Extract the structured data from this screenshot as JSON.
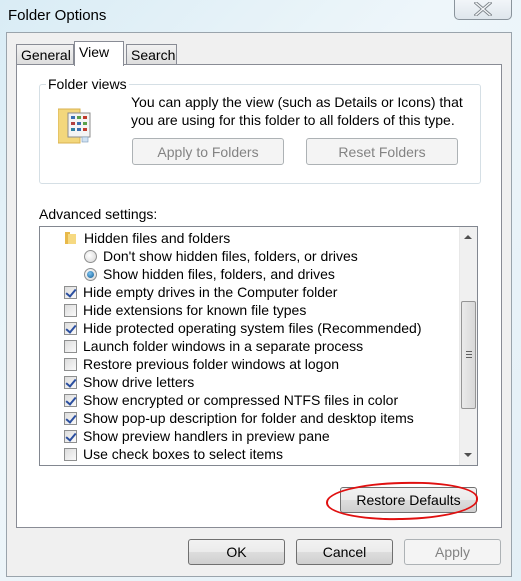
{
  "window": {
    "title": "Folder Options",
    "close_icon": "close-icon"
  },
  "tabs": [
    {
      "label": "General",
      "active": false
    },
    {
      "label": "View",
      "active": true
    },
    {
      "label": "Search",
      "active": false
    }
  ],
  "folder_views": {
    "legend": "Folder views",
    "icon": "folder-views-icon",
    "description": "You can apply the view (such as Details or Icons) that you are using for this folder to all folders of this type.",
    "apply_button": "Apply to Folders",
    "reset_button": "Reset Folders"
  },
  "advanced": {
    "label": "Advanced settings:",
    "items": [
      {
        "type": "folder",
        "label": "Hidden files and folders",
        "icon": "folder-icon"
      },
      {
        "type": "radio",
        "label": "Don't show hidden files, folders, or drives",
        "checked": false
      },
      {
        "type": "radio",
        "label": "Show hidden files, folders, and drives",
        "checked": true
      },
      {
        "type": "checkbox",
        "label": "Hide empty drives in the Computer folder",
        "checked": true
      },
      {
        "type": "checkbox",
        "label": "Hide extensions for known file types",
        "checked": false
      },
      {
        "type": "checkbox",
        "label": "Hide protected operating system files (Recommended)",
        "checked": true
      },
      {
        "type": "checkbox",
        "label": "Launch folder windows in a separate process",
        "checked": false
      },
      {
        "type": "checkbox",
        "label": "Restore previous folder windows at logon",
        "checked": false
      },
      {
        "type": "checkbox",
        "label": "Show drive letters",
        "checked": true
      },
      {
        "type": "checkbox",
        "label": "Show encrypted or compressed NTFS files in color",
        "checked": true
      },
      {
        "type": "checkbox",
        "label": "Show pop-up description for folder and desktop items",
        "checked": true
      },
      {
        "type": "checkbox",
        "label": "Show preview handlers in preview pane",
        "checked": true
      },
      {
        "type": "checkbox",
        "label": "Use check boxes to select items",
        "checked": false
      }
    ],
    "restore_defaults": "Restore Defaults"
  },
  "footer": {
    "ok": "OK",
    "cancel": "Cancel",
    "apply": "Apply"
  },
  "annotation_color": "#e01010"
}
